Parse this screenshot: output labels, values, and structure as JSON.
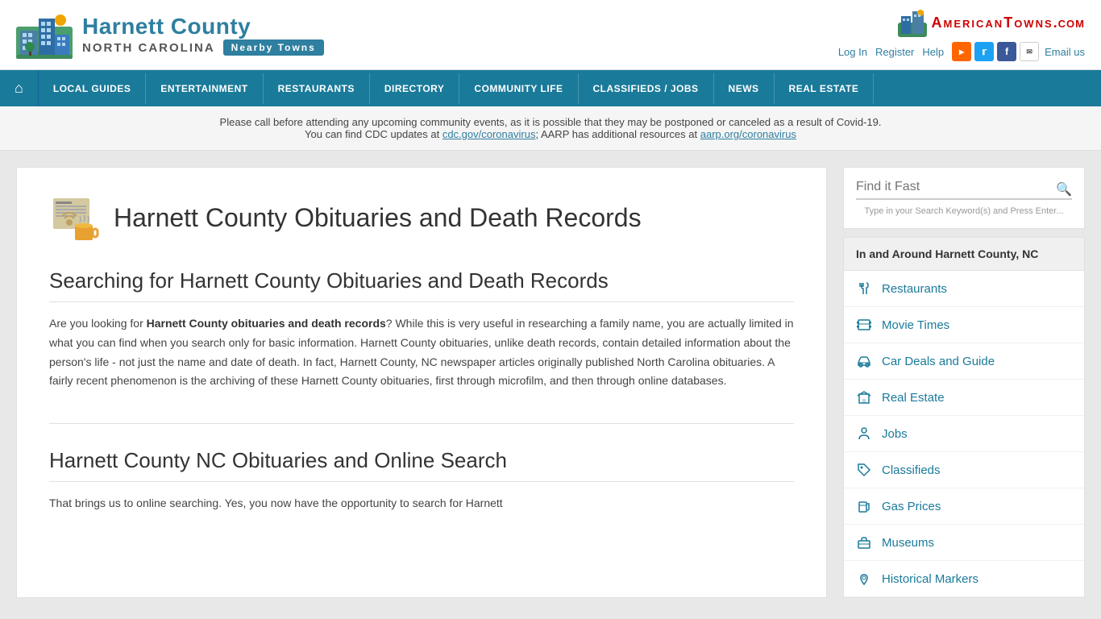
{
  "header": {
    "site_title": "Harnett County",
    "state": "NORTH CAROLINA",
    "nearby_btn": "Nearby Towns",
    "at_logo_text": "AmericanTowns.com",
    "login": "Log In",
    "register": "Register",
    "help": "Help",
    "email": "Email us"
  },
  "nav": {
    "items": [
      {
        "label": "LOCAL GUIDES"
      },
      {
        "label": "ENTERTAINMENT"
      },
      {
        "label": "RESTAURANTS"
      },
      {
        "label": "DIRECTORY"
      },
      {
        "label": "COMMUNITY LIFE"
      },
      {
        "label": "CLASSIFIEDS / JOBS"
      },
      {
        "label": "NEWS"
      },
      {
        "label": "REAL ESTATE"
      }
    ]
  },
  "alert": {
    "text1": "Please call before attending any upcoming community events, as it is possible that they may be postponed or canceled as a result of Covid-19.",
    "text2": "You can find CDC updates at cdc.gov/coronavirus; AARP has additional resources at aarp.org/coronavirus"
  },
  "page": {
    "title": "Harnett County Obituaries and Death Records",
    "section1_title": "Searching for Harnett County Obituaries and Death Records",
    "section1_body1": "Are you looking for ",
    "section1_bold": "Harnett County obituaries and death records",
    "section1_body2": "? While this is very useful in researching a family name, you are actually limited in what you can find when you search only for basic information. Harnett County obituaries, unlike death records, contain detailed information about the person’s life - not just the name and date of death. In fact, Harnett County, NC newspaper articles originally published North Carolina obituaries. A fairly recent phenomenon is the archiving of these Harnett County obituaries, first through microfilm, and then through online databases.",
    "section2_title": "Harnett County NC Obituaries and Online Search",
    "section2_body": "That brings us to online searching. Yes, you now have the opportunity to search for Harnett"
  },
  "search": {
    "placeholder": "Find it Fast",
    "hint": "Type in your Search Keyword(s) and Press Enter..."
  },
  "sidebar": {
    "local_header": "In and Around Harnett County, NC",
    "items": [
      {
        "label": "Restaurants",
        "icon": "fork-knife"
      },
      {
        "label": "Movie Times",
        "icon": "film"
      },
      {
        "label": "Car Deals and Guide",
        "icon": "car"
      },
      {
        "label": "Real Estate",
        "icon": "building"
      },
      {
        "label": "Jobs",
        "icon": "person"
      },
      {
        "label": "Classifieds",
        "icon": "tag"
      },
      {
        "label": "Gas Prices",
        "icon": "gas"
      },
      {
        "label": "Museums",
        "icon": "briefcase"
      },
      {
        "label": "Historical Markers",
        "icon": "pin"
      }
    ]
  }
}
